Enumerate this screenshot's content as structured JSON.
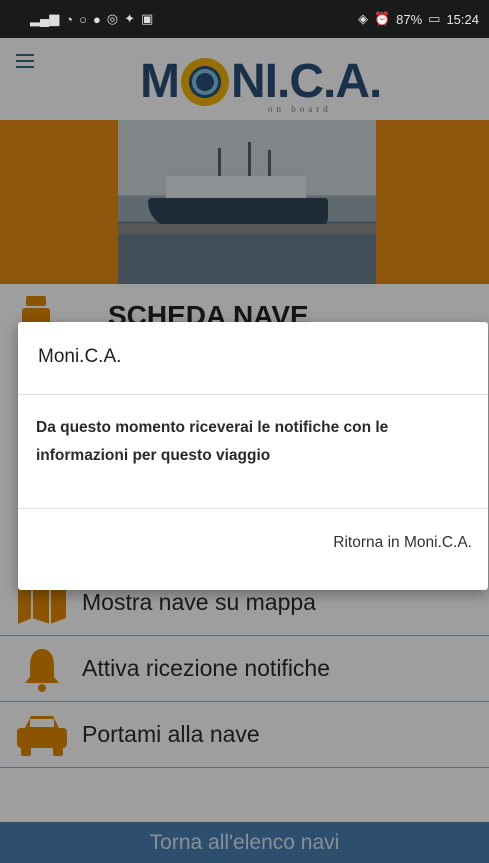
{
  "status_bar": {
    "battery": "87%",
    "time": "15:24"
  },
  "header": {
    "logo_text": "NI.C.A.",
    "logo_prefix": "M",
    "logo_subtitle": "on board"
  },
  "sheet": {
    "title": "SCHEDA NAVE"
  },
  "actions": [
    {
      "label": "Mostra nave su mappa",
      "icon": "map-icon"
    },
    {
      "label": "Attiva ricezione notifiche",
      "icon": "bell-icon"
    },
    {
      "label": "Portami alla nave",
      "icon": "taxi-icon"
    }
  ],
  "bottom_bar": {
    "label": "Torna all'elenco navi"
  },
  "dialog": {
    "title": "Moni.C.A.",
    "message": "Da questo momento riceverai le notifiche con le informazioni per questo viaggio",
    "button": "Ritorna in Moni.C.A."
  },
  "colors": {
    "accent_orange": "#e58a14",
    "brand_blue": "#2b4f79",
    "bottom_bar": "#4a7eb0"
  }
}
